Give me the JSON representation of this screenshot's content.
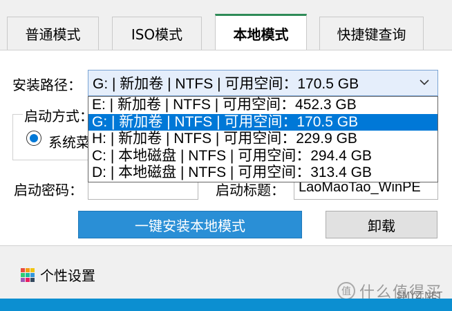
{
  "tabs": [
    {
      "label": "普通模式"
    },
    {
      "label": "ISO模式"
    },
    {
      "label": "本地模式"
    },
    {
      "label": "快捷键查询"
    }
  ],
  "install_path": {
    "label": "安装路径：",
    "selected": "G: | 新加卷 | NTFS | 可用空间：170.5 GB",
    "options": [
      "E: | 新加卷 | NTFS | 可用空间：452.3 GB",
      "G: | 新加卷 | NTFS | 可用空间：170.5 GB",
      "H: | 新加卷 | NTFS | 可用空间：229.9 GB",
      "C: | 本地磁盘 | NTFS | 可用空间：294.4 GB",
      "D: | 本地磁盘 | NTFS | 可用空间：313.4 GB"
    ],
    "highlighted_index": 1
  },
  "boot_mode": {
    "label": "启动方式：",
    "radio_label": "系统菜"
  },
  "password": {
    "label": "启动密码：",
    "value": ""
  },
  "boot_title": {
    "label": "启动标题：",
    "value": "LaoMaoTao_WinPE"
  },
  "buttons": {
    "install": "一键安装本地模式",
    "uninstall": "卸载"
  },
  "settings_label": "个性设置",
  "watermark": {
    "text": "什么值得买",
    "site": "SMYZ.NET",
    "badge": "值"
  },
  "colors": {
    "accent": "#0078d7",
    "primary_button": "#2a8fd6",
    "active_tab_indicator": "#2e8b57",
    "bottom_bar": "#0c8fd1"
  }
}
